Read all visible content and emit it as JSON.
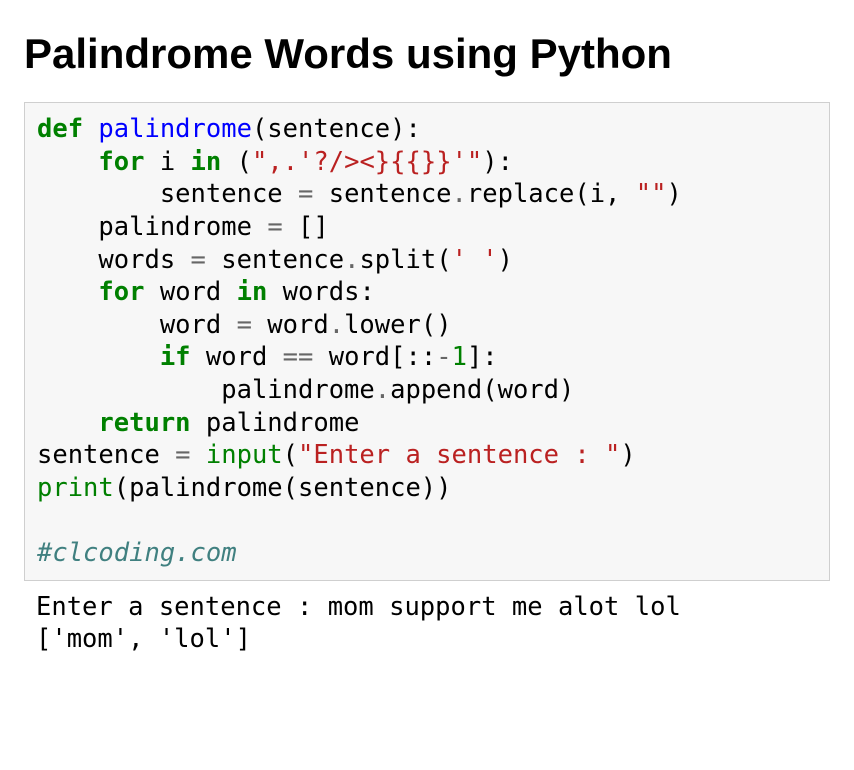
{
  "title": "Palindrome Words using Python",
  "code": {
    "l1": {
      "kw_def": "def",
      "fn": "palindrome",
      "after": "(sentence):"
    },
    "l2": {
      "pad": "    ",
      "kw_for": "for",
      "t1": " i ",
      "kw_in": "in",
      "t2": " (",
      "str": "\",.'?/><}{{}}'\"",
      "t3": "):"
    },
    "l3": {
      "pad": "        ",
      "t1": "sentence ",
      "op": "=",
      "t2": " sentence",
      "op2": ".",
      "t3": "replace(i, ",
      "str": "\"\"",
      "t4": ")"
    },
    "l4": {
      "pad": "    ",
      "t1": "palindrome ",
      "op": "=",
      "t2": " []"
    },
    "l5": {
      "pad": "    ",
      "t1": "words ",
      "op": "=",
      "t2": " sentence",
      "op2": ".",
      "t3": "split(",
      "str": "' '",
      "t4": ")"
    },
    "l6": {
      "pad": "    ",
      "kw_for": "for",
      "t1": " word ",
      "kw_in": "in",
      "t2": " words:"
    },
    "l7": {
      "pad": "        ",
      "t1": "word ",
      "op": "=",
      "t2": " word",
      "op2": ".",
      "t3": "lower()"
    },
    "l8": {
      "pad": "        ",
      "kw_if": "if",
      "t1": " word ",
      "op": "==",
      "t2": " word[::",
      "op2": "-",
      "num": "1",
      "t3": "]:"
    },
    "l9": {
      "pad": "            ",
      "t1": "palindrome",
      "op": ".",
      "t2": "append(word)"
    },
    "l10": {
      "pad": "    ",
      "kw_return": "return",
      "t1": " palindrome"
    },
    "l11": {
      "t1": "sentence ",
      "op": "=",
      "t2": " ",
      "bi": "input",
      "t3": "(",
      "str": "\"Enter a sentence : \"",
      "t4": ")"
    },
    "l12": {
      "bi": "print",
      "t1": "(palindrome(sentence))"
    },
    "l13": {
      "blank": ""
    },
    "l14": {
      "comment": "#clcoding.com"
    }
  },
  "output": {
    "line1": "Enter a sentence : mom support me alot lol",
    "line2": "['mom', 'lol']"
  }
}
